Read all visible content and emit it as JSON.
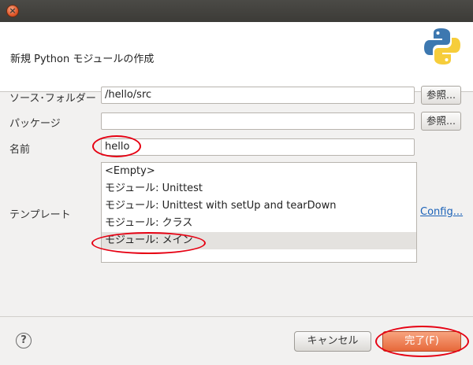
{
  "window": {
    "close_glyph": "×"
  },
  "header": {
    "title": "新規 Python モジュールの作成",
    "logo_icon": "python-logo-icon"
  },
  "form": {
    "source_folder": {
      "label": "ソース･フォルダー",
      "value": "/hello/src",
      "browse_label": "参照..."
    },
    "package": {
      "label": "パッケージ",
      "value": "",
      "browse_label": "参照..."
    },
    "name": {
      "label": "名前",
      "value": "hello"
    },
    "template": {
      "label": "テンプレート",
      "items": [
        "<Empty>",
        "モジュール: Unittest",
        "モジュール: Unittest with setUp and tearDown",
        "モジュール: クラス",
        "モジュール: メイン"
      ],
      "selected_index": 4,
      "config_link": "Config..."
    }
  },
  "footer": {
    "help_glyph": "?",
    "cancel_label": "キャンセル",
    "finish_label": "完了(F)"
  },
  "annotation_color": "#e60012"
}
